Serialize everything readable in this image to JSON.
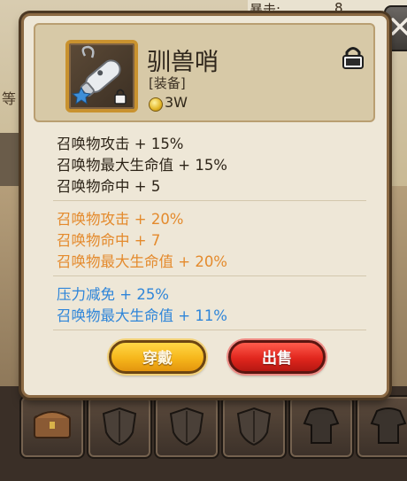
{
  "background": {
    "crit_label": "暴击:",
    "crit_value": "8",
    "level_label": "等",
    "left_arrow": "⇦"
  },
  "item": {
    "name": "驯兽哨",
    "type": "[装备]",
    "price": "3W",
    "icon": "whistle-icon",
    "locked": true
  },
  "stats": {
    "base": [
      "召唤物攻击 + 15%",
      "召唤物最大生命值 + 15%",
      "召唤物命中 + 5"
    ],
    "bonus_orange": [
      "召唤物攻击 + 20%",
      "召唤物命中 + 7",
      "召唤物最大生命值 + 20%"
    ],
    "bonus_blue": [
      "压力减免 + 25%",
      "召唤物最大生命值 + 11%"
    ]
  },
  "buttons": {
    "equip_label": "穿戴",
    "sell_label": "出售"
  },
  "colors": {
    "base_text": "#2d2418",
    "orange_stat": "#e48a2c",
    "blue_stat": "#2e85d9",
    "equip_button": "#f6b61b",
    "sell_button": "#e1261d"
  }
}
